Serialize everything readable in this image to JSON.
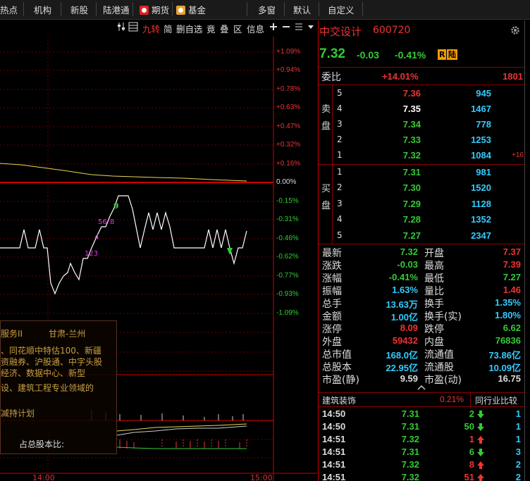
{
  "menu": {
    "items": [
      "热点",
      "机构",
      "新股",
      "陆港通",
      "期货",
      "基金",
      "多窗",
      "默认",
      "自定义"
    ]
  },
  "chart_tools": {
    "items": [
      "九转",
      "简",
      "删自选",
      "竟",
      "叠",
      "区",
      "信息"
    ]
  },
  "chart": {
    "pct_labels": [
      "+1.09%",
      "+0.94%",
      "+0.78%",
      "+0.63%",
      "+0.47%",
      "+0.32%",
      "+0.16%",
      "0.00%",
      "-0.15%",
      "-0.31%",
      "-0.46%",
      "-0.62%",
      "-0.77%",
      "-0.93%",
      "-1.09%"
    ],
    "time_labels": [
      "14:00",
      "15:00"
    ],
    "markers": [
      "9",
      "56",
      "8",
      "4",
      "123"
    ]
  },
  "info": {
    "lines": [
      "服务II",
      "甘肃-兰州",
      "、同花顺中特估100、新疆",
      "资融券、沪股通、中字头股",
      "经济、数据中心、新型",
      "设、建筑工程专业领域的",
      "减持计划",
      "占总股本比:"
    ]
  },
  "stock": {
    "name": "中交设计",
    "code": "600720",
    "price": "7.32",
    "change": "-0.03",
    "change_pct": "-0.41%",
    "tags": [
      "R",
      "陆"
    ]
  },
  "order_book": {
    "weibi_label": "委比",
    "weibi_pct": "+14.01%",
    "weibi_diff": "1801",
    "sell_label": [
      "卖",
      "盘"
    ],
    "buy_label": [
      "买",
      "盘"
    ],
    "sell": [
      {
        "lvl": "5",
        "price": "7.36",
        "vol": "945",
        "delta": ""
      },
      {
        "lvl": "4",
        "price": "7.35",
        "vol": "1467",
        "delta": ""
      },
      {
        "lvl": "3",
        "price": "7.34",
        "vol": "778",
        "delta": ""
      },
      {
        "lvl": "2",
        "price": "7.33",
        "vol": "1253",
        "delta": ""
      },
      {
        "lvl": "1",
        "price": "7.32",
        "vol": "1084",
        "delta": "+16"
      }
    ],
    "buy": [
      {
        "lvl": "1",
        "price": "7.31",
        "vol": "981"
      },
      {
        "lvl": "2",
        "price": "7.30",
        "vol": "1520"
      },
      {
        "lvl": "3",
        "price": "7.29",
        "vol": "1128"
      },
      {
        "lvl": "4",
        "price": "7.28",
        "vol": "1352"
      },
      {
        "lvl": "5",
        "price": "7.27",
        "vol": "2347"
      }
    ]
  },
  "quote": {
    "rows": [
      {
        "l1": "最新",
        "v1": "7.32",
        "c1": "#3c3",
        "l2": "开盘",
        "v2": "7.37",
        "c2": "#e33"
      },
      {
        "l1": "涨跌",
        "v1": "-0.03",
        "c1": "#3c3",
        "l2": "最高",
        "v2": "7.39",
        "c2": "#e33"
      },
      {
        "l1": "涨幅",
        "v1": "-0.41%",
        "c1": "#3c3",
        "l2": "最低",
        "v2": "7.27",
        "c2": "#3c3"
      },
      {
        "l1": "振幅",
        "v1": "1.63%",
        "c1": "#3cf",
        "l2": "量比",
        "v2": "1.46",
        "c2": "#e33"
      },
      {
        "l1": "总手",
        "v1": "13.63万",
        "c1": "#3cf",
        "l2": "换手",
        "v2": "1.35%",
        "c2": "#3cf"
      },
      {
        "l1": "金额",
        "v1": "1.00亿",
        "c1": "#3cf",
        "l2": "换手(实)",
        "v2": "1.80%",
        "c2": "#3cf"
      },
      {
        "l1": "涨停",
        "v1": "8.09",
        "c1": "#e33",
        "l2": "跌停",
        "v2": "6.62",
        "c2": "#3c3"
      },
      {
        "l1": "外盘",
        "v1": "59432",
        "c1": "#e33",
        "l2": "内盘",
        "v2": "76836",
        "c2": "#3c3"
      },
      {
        "l1": "总市值",
        "v1": "168.0亿",
        "c1": "#3cf",
        "l2": "流通值",
        "v2": "73.86亿",
        "c2": "#3cf"
      },
      {
        "l1": "总股本",
        "v1": "22.95亿",
        "c1": "#3cf",
        "l2": "流通股",
        "v2": "10.09亿",
        "c2": "#3cf"
      },
      {
        "l1": "市盈(静)",
        "v1": "9.59",
        "c1": "#ddd",
        "l2": "市盈(动)",
        "v2": "16.75",
        "c2": "#ddd"
      }
    ]
  },
  "industry": {
    "name": "建筑装饰",
    "pct": "0.21%",
    "compare_label": "同行业比较"
  },
  "ticks": [
    {
      "time": "14:50",
      "price": "7.31",
      "pc": "#3c3",
      "vol": "2",
      "vc": "#3c3",
      "dir": "down",
      "n": "1"
    },
    {
      "time": "14:50",
      "price": "7.31",
      "pc": "#3c3",
      "vol": "50",
      "vc": "#3c3",
      "dir": "down",
      "n": "1"
    },
    {
      "time": "14:51",
      "price": "7.32",
      "pc": "#3c3",
      "vol": "1",
      "vc": "#e33",
      "dir": "up",
      "n": "1"
    },
    {
      "time": "14:51",
      "price": "7.31",
      "pc": "#3c3",
      "vol": "6",
      "vc": "#3c3",
      "dir": "down",
      "n": "3"
    },
    {
      "time": "14:51",
      "price": "7.32",
      "pc": "#3c3",
      "vol": "8",
      "vc": "#e33",
      "dir": "up",
      "n": "2"
    },
    {
      "time": "14:51",
      "price": "7.32",
      "pc": "#3c3",
      "vol": "51",
      "vc": "#e33",
      "dir": "up",
      "n": "2"
    }
  ]
}
